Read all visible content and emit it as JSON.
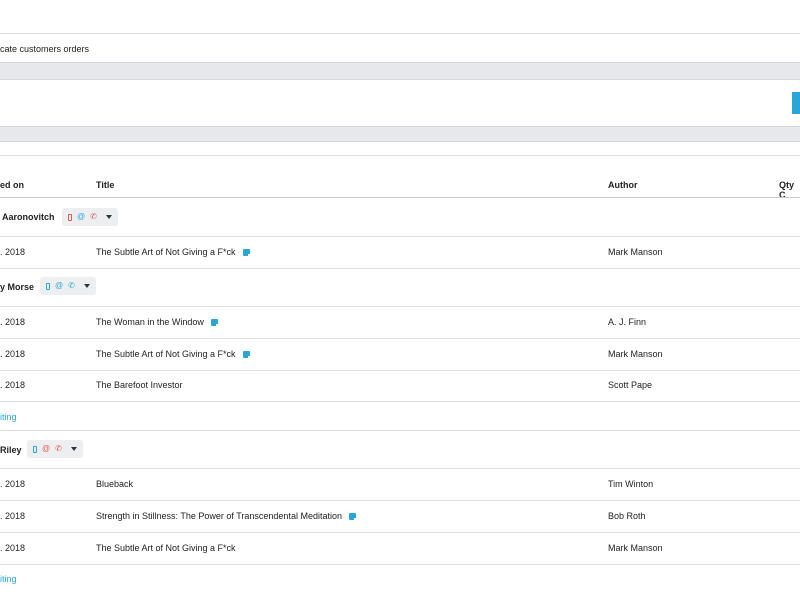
{
  "page": {
    "subtitle": "cate customers orders",
    "colors": {
      "accent": "#29a6d9",
      "red": "#e05a5a",
      "blue": "#29a6d9",
      "band": "#e6e8eb"
    }
  },
  "table": {
    "headers": {
      "ordered_on": "ed on",
      "title": "Title",
      "author": "Author",
      "qty": "Qty C"
    }
  },
  "customers": [
    {
      "name": "Aaronovitch",
      "contacts": {
        "mobile": "red",
        "email": "blue",
        "phone": "red"
      },
      "orders": [
        {
          "date": ". 2018",
          "title": "The Subtle Art of Not Giving a F*ck",
          "note": true,
          "author": "Mark Manson"
        }
      ]
    },
    {
      "name": "y Morse",
      "contacts": {
        "mobile": "blue",
        "email": "blue",
        "phone": "blue"
      },
      "orders": [
        {
          "date": ". 2018",
          "title": "The Woman in the Window",
          "note": true,
          "author": "A. J. Finn"
        },
        {
          "date": ". 2018",
          "title": "The Subtle Art of Not Giving a F*ck",
          "note": true,
          "author": "Mark Manson"
        },
        {
          "date": ". 2018",
          "title": "The Barefoot Investor",
          "note": false,
          "author": "Scott Pape"
        }
      ],
      "link": "iting"
    },
    {
      "name": "Riley",
      "contacts": {
        "mobile": "blue",
        "email": "red",
        "phone": "red"
      },
      "orders": [
        {
          "date": ". 2018",
          "title": "Blueback",
          "note": false,
          "author": "Tim Winton"
        },
        {
          "date": ". 2018",
          "title": "Strength in Stillness: The Power of Transcendental Meditation",
          "note": true,
          "author": "Bob Roth"
        },
        {
          "date": ". 2018",
          "title": "The Subtle Art of Not Giving a F*ck",
          "note": false,
          "author": "Mark Manson"
        }
      ],
      "link": "iting"
    }
  ]
}
